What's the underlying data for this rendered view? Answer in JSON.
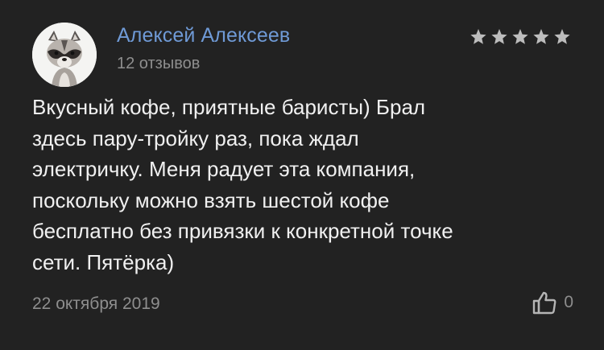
{
  "review": {
    "author_name": "Алексей Алексеев",
    "review_count": "12 отзывов",
    "rating": 5,
    "rating_max": 5,
    "text": "Вкусный кофе, приятные баристы) Брал\nздесь пару-тройку раз, пока ждал\nэлектричку. Меня радует эта компания,\nпоскольку можно взять шестой кофе\nбесплатно без привязки к конкретной точке\nсети. Пятёрка)",
    "date": "22 октября 2019",
    "likes": "0"
  },
  "icons": {
    "avatar": "raccoon-avatar",
    "star": "star-icon",
    "like": "thumbs-up-icon"
  },
  "colors": {
    "background": "#222222",
    "author_name": "#6f9ad6",
    "text": "#f0f0f0",
    "muted": "#8e8e8e",
    "star": "#bdbdbd"
  }
}
